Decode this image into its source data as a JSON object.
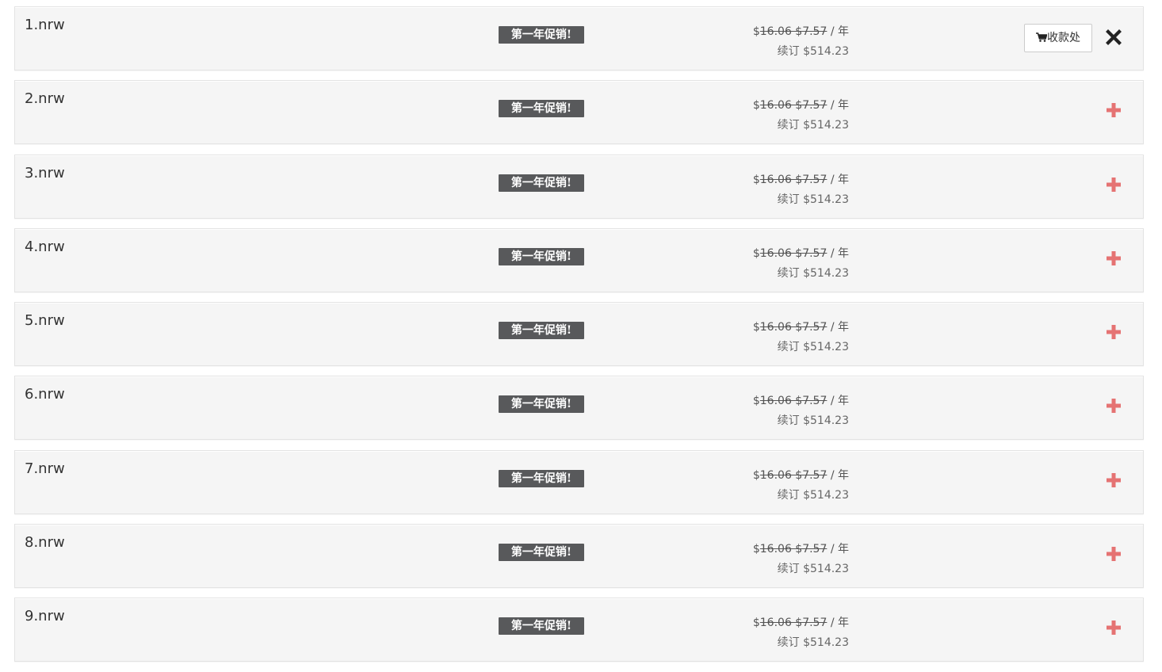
{
  "icons": {
    "add": "plus-icon",
    "remove": "close-icon",
    "cart": "cart-icon"
  },
  "colors": {
    "row_bg": "#f5f5f5",
    "promo_bg": "#58595b",
    "add_icon": "#e57373",
    "remove_icon": "#222222"
  },
  "checkout": {
    "label": "收款处"
  },
  "rows": [
    {
      "domain": "1.nrw",
      "promo": "第一年促销!",
      "price_currency": "$",
      "original_price": "16.06 $7.57",
      "per_year": " / 年",
      "renewal": "续订 $514.23"
    },
    {
      "domain": "2.nrw",
      "promo": "第一年促销!",
      "price_currency": "$",
      "original_price": "16.06 $7.57",
      "per_year": " / 年",
      "renewal": "续订 $514.23"
    },
    {
      "domain": "3.nrw",
      "promo": "第一年促销!",
      "price_currency": "$",
      "original_price": "16.06 $7.57",
      "per_year": " / 年",
      "renewal": "续订 $514.23"
    },
    {
      "domain": "4.nrw",
      "promo": "第一年促销!",
      "price_currency": "$",
      "original_price": "16.06 $7.57",
      "per_year": " / 年",
      "renewal": "续订 $514.23"
    },
    {
      "domain": "5.nrw",
      "promo": "第一年促销!",
      "price_currency": "$",
      "original_price": "16.06 $7.57",
      "per_year": " / 年",
      "renewal": "续订 $514.23"
    },
    {
      "domain": "6.nrw",
      "promo": "第一年促销!",
      "price_currency": "$",
      "original_price": "16.06 $7.57",
      "per_year": " / 年",
      "renewal": "续订 $514.23"
    },
    {
      "domain": "7.nrw",
      "promo": "第一年促销!",
      "price_currency": "$",
      "original_price": "16.06 $7.57",
      "per_year": " / 年",
      "renewal": "续订 $514.23"
    },
    {
      "domain": "8.nrw",
      "promo": "第一年促销!",
      "price_currency": "$",
      "original_price": "16.06 $7.57",
      "per_year": " / 年",
      "renewal": "续订 $514.23"
    },
    {
      "domain": "9.nrw",
      "promo": "第一年促销!",
      "price_currency": "$",
      "original_price": "16.06 $7.57",
      "per_year": " / 年",
      "renewal": "续订 $514.23"
    }
  ]
}
